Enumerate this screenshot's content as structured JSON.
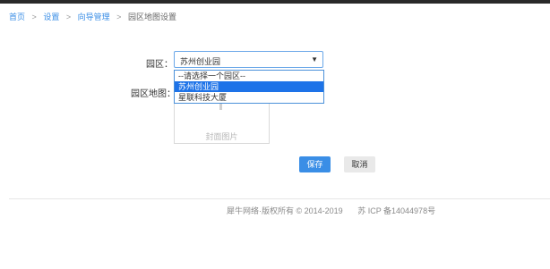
{
  "breadcrumb": {
    "home": "首页",
    "settings": "设置",
    "guide_manage": "向导管理",
    "current": "园区地图设置",
    "separator": ">"
  },
  "form": {
    "park_label": "园区：",
    "park_selected": "苏州创业园",
    "map_label": "园区地图：",
    "dropdown_options": [
      "--请选择一个园区--",
      "苏州创业园",
      "星联科技大厦"
    ],
    "uploader_placeholder": "封面图片"
  },
  "buttons": {
    "save": "保存",
    "cancel": "取消"
  },
  "footer": {
    "copyright": "犀牛网络·版权所有 © 2014-2019",
    "icp": "苏 ICP 备14044978号"
  },
  "colors": {
    "accent": "#3a8ee6",
    "selected_option": "#1e73e8",
    "topbar": "#2a2a2a"
  },
  "icons": {
    "caret": "chevron-down-icon",
    "upload": "upload-icon"
  }
}
